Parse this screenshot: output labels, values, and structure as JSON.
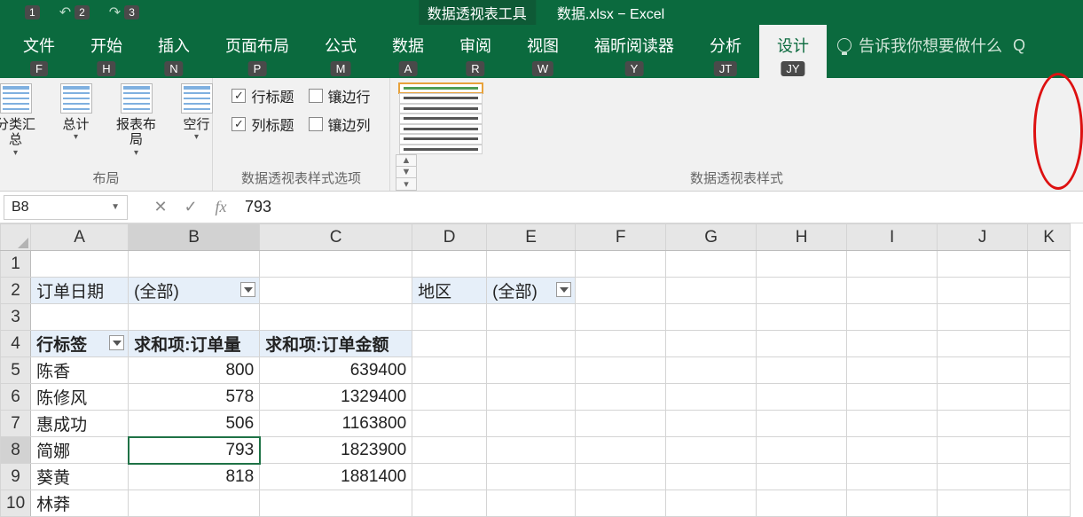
{
  "titlebar": {
    "qat": [
      {
        "key": "1"
      },
      {
        "key": "2"
      },
      {
        "key": "3"
      }
    ],
    "tool_context": "数据透视表工具",
    "file_title": "数据.xlsx  −  Excel"
  },
  "tabs": {
    "file": {
      "label": "文件",
      "key": "F"
    },
    "home": {
      "label": "开始",
      "key": "H"
    },
    "insert": {
      "label": "插入",
      "key": "N"
    },
    "layout": {
      "label": "页面布局",
      "key": "P"
    },
    "formula": {
      "label": "公式",
      "key": "M"
    },
    "data": {
      "label": "数据",
      "key": "A"
    },
    "review": {
      "label": "审阅",
      "key": "R"
    },
    "view": {
      "label": "视图",
      "key": "W"
    },
    "foxit": {
      "label": "福昕阅读器",
      "key": "Y"
    },
    "analyze": {
      "label": "分析",
      "key": "JT"
    },
    "design": {
      "label": "设计",
      "key": "JY"
    },
    "tell_me": "告诉我你想要做什么",
    "tell_me_key": "Q"
  },
  "ribbon": {
    "layout_group_label": "布局",
    "buttons": {
      "subtotals": "分类汇总",
      "grand": "总计",
      "report": "报表布局",
      "blank": "空行"
    },
    "style_options_label": "数据透视表样式选项",
    "opts": {
      "row_header": "行标题",
      "banded_row": "镶边行",
      "col_header": "列标题",
      "banded_col": "镶边列"
    },
    "styles_label": "数据透视表样式"
  },
  "formula_bar": {
    "name_box": "B8",
    "value": "793"
  },
  "columns": [
    "A",
    "B",
    "C",
    "D",
    "E",
    "F",
    "G",
    "H",
    "I",
    "J",
    "K"
  ],
  "sheet": {
    "row2": {
      "A_label": "订单日期",
      "A_value": "(全部)",
      "D_label": "地区",
      "D_value": "(全部)"
    },
    "row4": {
      "A": "行标签",
      "B": "求和项:订单量",
      "C": "求和项:订单金额"
    },
    "rows": [
      {
        "n": "5",
        "A": "陈香",
        "B": "800",
        "C": "639400"
      },
      {
        "n": "6",
        "A": "陈修风",
        "B": "578",
        "C": "1329400"
      },
      {
        "n": "7",
        "A": "惠成功",
        "B": "506",
        "C": "1163800"
      },
      {
        "n": "8",
        "A": "简娜",
        "B": "793",
        "C": "1823900"
      },
      {
        "n": "9",
        "A": "葵黄",
        "B": "818",
        "C": "1881400"
      },
      {
        "n": "10",
        "A": "林莽",
        "B": "",
        "C": ""
      }
    ]
  }
}
